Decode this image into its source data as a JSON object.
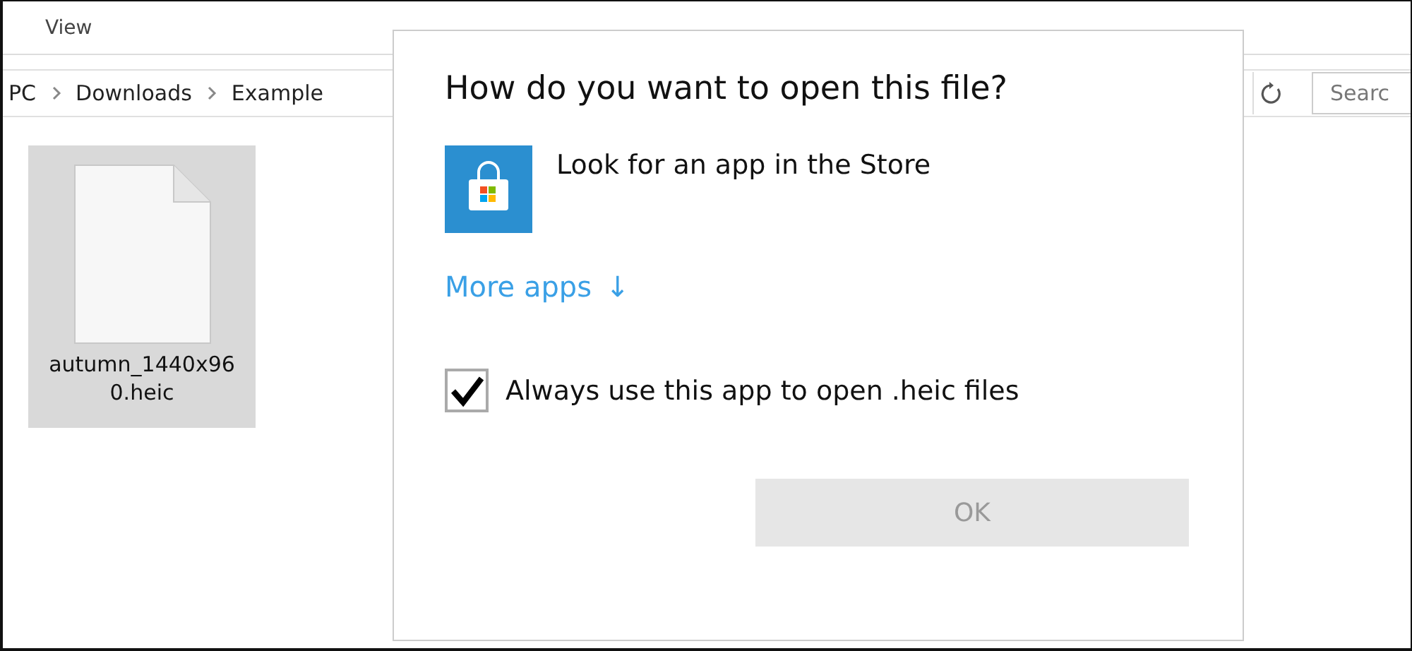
{
  "explorer": {
    "menu": [
      {
        "label": "View"
      }
    ],
    "breadcrumb": [
      {
        "label": "PC"
      },
      {
        "label": "Downloads"
      },
      {
        "label": "Example"
      }
    ],
    "search": {
      "placeholder": "Searc"
    },
    "files": [
      {
        "name": "autumn_1440x960.heic",
        "selected": true
      }
    ]
  },
  "dialog": {
    "title": "How do you want to open this file?",
    "apps": [
      {
        "name": "Look for an app in the Store"
      }
    ],
    "more_link": "More apps",
    "more_arrow": "↓",
    "always_use": {
      "label": "Always use this app to open .heic files",
      "checked": true
    },
    "ok_button": {
      "label": "OK",
      "disabled": true
    }
  }
}
